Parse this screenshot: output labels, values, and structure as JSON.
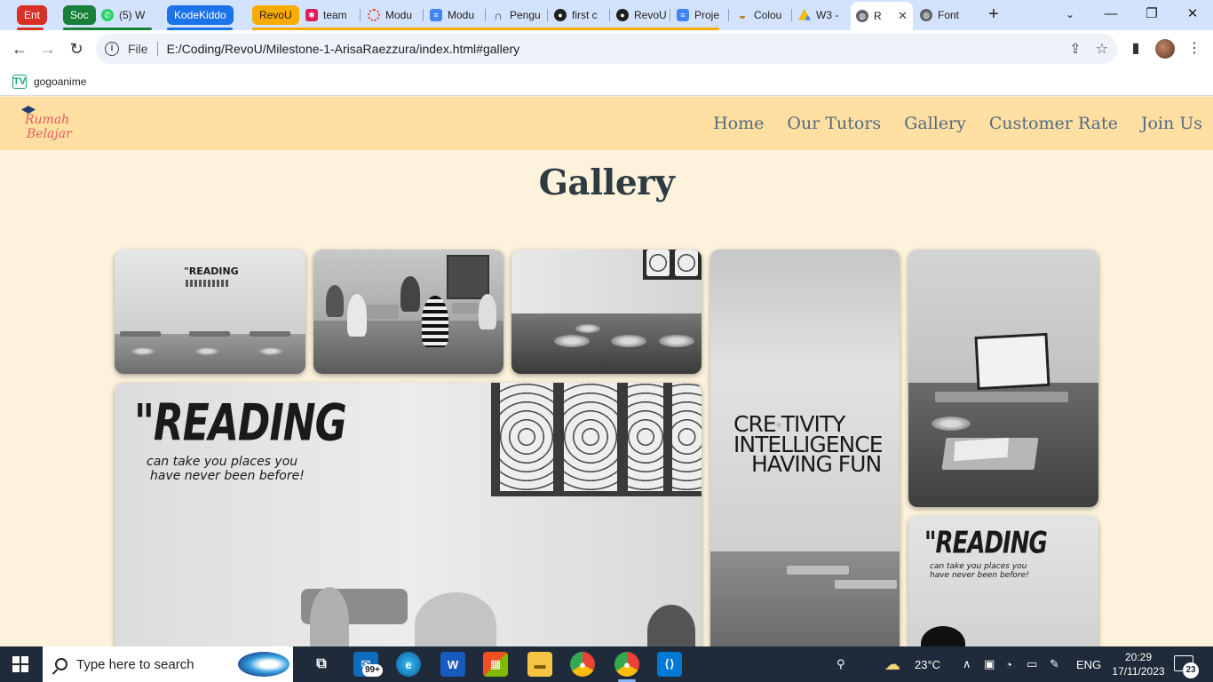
{
  "browser": {
    "tab_groups": [
      {
        "label": "Ent",
        "color": "#d93025"
      },
      {
        "label": "Soc",
        "color": "#188038"
      },
      {
        "label": "KodeKiddo",
        "color": "#1a73e8"
      },
      {
        "label": "RevoU",
        "color": "#f9ab00"
      }
    ],
    "tabs": [
      {
        "title": "(5) W",
        "icon": "whatsapp-icon",
        "color": "#25d366"
      },
      {
        "title": "team",
        "icon": "slack-icon",
        "color": "#e01e5a"
      },
      {
        "title": "Modu",
        "icon": "ring-icon",
        "color": "#e24a2b"
      },
      {
        "title": "Modu",
        "icon": "docs-icon",
        "color": "#4285f4"
      },
      {
        "title": "Pengu",
        "icon": "headset-icon",
        "color": "#333333"
      },
      {
        "title": "first c",
        "icon": "github-icon",
        "color": "#1f1f1f"
      },
      {
        "title": "RevoU",
        "icon": "github-icon",
        "color": "#1f1f1f"
      },
      {
        "title": "Proje",
        "icon": "docs-icon",
        "color": "#4285f4"
      },
      {
        "title": "Colou",
        "icon": "color-icon",
        "color": "#c07a20"
      },
      {
        "title": "W3 -",
        "icon": "drive-icon",
        "color": "#34a853"
      },
      {
        "title": "R",
        "icon": "globe-icon",
        "color": "#5f6368",
        "active": true
      },
      {
        "title": "Font",
        "icon": "globe-icon",
        "color": "#5f6368"
      }
    ],
    "url_scheme_label": "File",
    "url": "E:/Coding/RevoU/Milestone-1-ArisaRaezzura/index.html#gallery",
    "bookmarks": [
      {
        "label": "gogoanime",
        "icon": "tv-icon"
      }
    ]
  },
  "site": {
    "logo_line1": "Rumah",
    "logo_line2": "Belajar",
    "nav": [
      "Home",
      "Our Tutors",
      "Gallery",
      "Customer Rate",
      "Join Us"
    ],
    "gallery_title": "Gallery"
  },
  "photos": {
    "p1_quote": "\"READING",
    "p5_line1": "CRE",
    "p5_line1b": "TIVITY",
    "p5_line2": "INTELLIGENCE",
    "p5_line3": "HAVING FUN",
    "p6_quote_big": "\"READING",
    "p6_quote_l1": "can take you places you",
    "p6_quote_l2": "have never been before!",
    "p8_quote_big": "\"READING",
    "p8_quote_l1": "can take you places you",
    "p8_quote_l2": "have never been before!"
  },
  "taskbar": {
    "search_placeholder": "Type here to search",
    "mail_badge": "99+",
    "weather": "23°C",
    "language": "ENG",
    "time": "20:29",
    "date": "17/11/2023",
    "notification_count": "23"
  }
}
